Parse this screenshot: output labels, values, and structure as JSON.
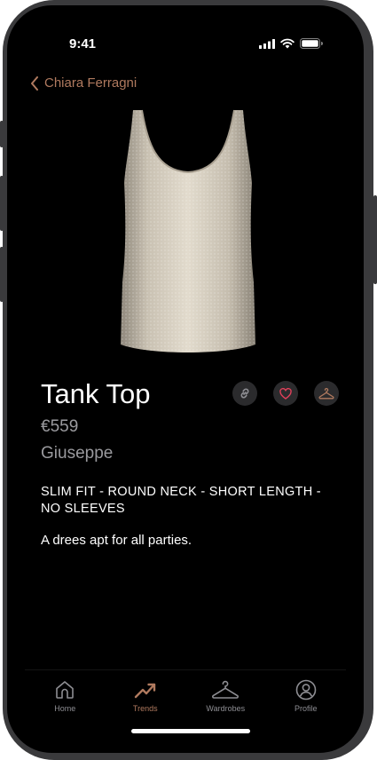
{
  "status_bar": {
    "time": "9:41"
  },
  "nav": {
    "back_label": "Chiara Ferragni"
  },
  "product": {
    "name": "Tank Top",
    "price": "€559",
    "brand": "Giuseppe",
    "specs": "SLIM FIT - ROUND NECK - SHORT LENGTH - NO SLEEVES",
    "description": "A drees apt for all parties.",
    "image": "sequin-tank-top-image"
  },
  "actions": [
    {
      "icon": "link-icon"
    },
    {
      "icon": "heart-icon"
    },
    {
      "icon": "hanger-icon"
    }
  ],
  "tabbar": {
    "tabs": [
      {
        "label": "Home",
        "icon": "home-icon",
        "active": false
      },
      {
        "label": "Trends",
        "icon": "trend-up-icon",
        "active": true
      },
      {
        "label": "Wardrobes",
        "icon": "hanger-icon",
        "active": false
      },
      {
        "label": "Profile",
        "icon": "profile-icon",
        "active": false
      }
    ]
  },
  "colors": {
    "accent": "#b07a5f",
    "background": "#000000",
    "muted": "#9a9a9e"
  }
}
